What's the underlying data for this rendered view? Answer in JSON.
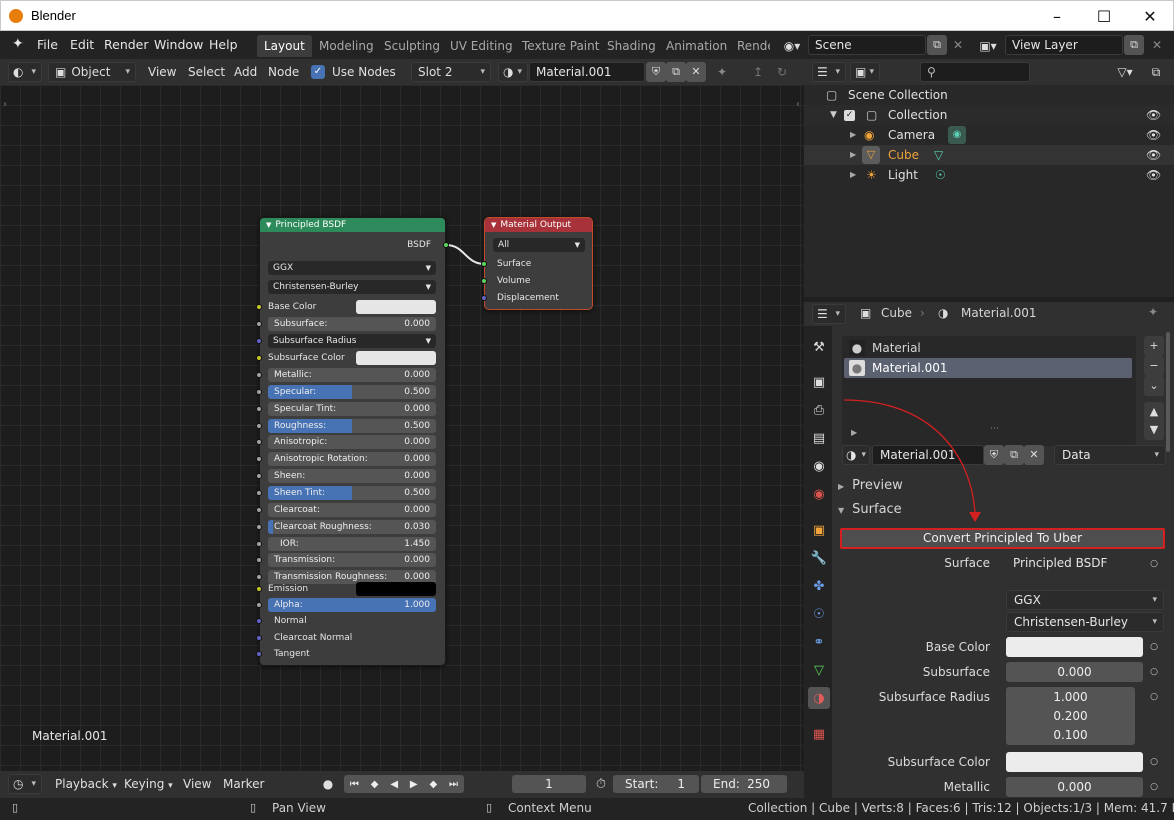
{
  "window": {
    "title": "Blender"
  },
  "menubar": {
    "items": [
      "File",
      "Edit",
      "Render",
      "Window",
      "Help"
    ]
  },
  "workspaces": [
    "Layout",
    "Modeling",
    "Sculpting",
    "UV Editing",
    "Texture Paint",
    "Shading",
    "Animation",
    "Rende"
  ],
  "scene": {
    "name": "Scene",
    "view_layer": "View Layer"
  },
  "node_header": {
    "mode": "Object",
    "view": "View",
    "select": "Select",
    "add": "Add",
    "node": "Node",
    "use_nodes_label": "Use Nodes",
    "use_nodes": true,
    "slot": "Slot 2",
    "material": "Material.001"
  },
  "node_editor": {
    "material_label": "Material.001"
  },
  "principled": {
    "title": "Principled BSDF",
    "output": "BSDF",
    "distribution": "GGX",
    "subsurface_method": "Christensen-Burley",
    "base_color_label": "Base Color",
    "subsurface_label": "Subsurface:",
    "subsurface_value": "0.000",
    "subsurface_radius_label": "Subsurface Radius",
    "subsurface_color_label": "Subsurface Color",
    "sliders": [
      {
        "label": "Metallic:",
        "value": "0.000",
        "fill": 0
      },
      {
        "label": "Specular:",
        "value": "0.500",
        "fill": 0.5
      },
      {
        "label": "Specular Tint:",
        "value": "0.000",
        "fill": 0
      },
      {
        "label": "Roughness:",
        "value": "0.500",
        "fill": 0.5
      },
      {
        "label": "Anisotropic:",
        "value": "0.000",
        "fill": 0
      },
      {
        "label": "Anisotropic Rotation:",
        "value": "0.000",
        "fill": 0
      },
      {
        "label": "Sheen:",
        "value": "0.000",
        "fill": 0
      },
      {
        "label": "Sheen Tint:",
        "value": "0.500",
        "fill": 0.5
      },
      {
        "label": "Clearcoat:",
        "value": "0.000",
        "fill": 0
      },
      {
        "label": "Clearcoat Roughness:",
        "value": "0.030",
        "fill": 0.03
      },
      {
        "label": "IOR:",
        "value": "1.450",
        "fill": 0
      },
      {
        "label": "Transmission:",
        "value": "0.000",
        "fill": 0
      },
      {
        "label": "Transmission Roughness:",
        "value": "0.000",
        "fill": 0
      }
    ],
    "emission_label": "Emission",
    "alpha_label": "Alpha:",
    "alpha_value": "1.000",
    "normal_label": "Normal",
    "clearcoat_normal_label": "Clearcoat Normal",
    "tangent_label": "Tangent"
  },
  "material_output": {
    "title": "Material Output",
    "target": "All",
    "inputs": [
      "Surface",
      "Volume",
      "Displacement"
    ]
  },
  "timeline": {
    "playback": "Playback",
    "keying": "Keying",
    "view": "View",
    "marker": "Marker",
    "frame": "1",
    "start_label": "Start:",
    "start": "1",
    "end_label": "End:",
    "end": "250"
  },
  "status": {
    "pan": "Pan View",
    "context": "Context Menu",
    "info": "Collection | Cube | Verts:8 | Faces:6 | Tris:12 | Objects:1/3 | Mem: 41.7 MB | v2.80.75"
  },
  "outliner": {
    "scene_collection": "Scene Collection",
    "items": [
      {
        "name": "Collection",
        "depth": 1
      },
      {
        "name": "Camera",
        "depth": 2
      },
      {
        "name": "Cube",
        "depth": 2,
        "active": true
      },
      {
        "name": "Light",
        "depth": 2
      }
    ]
  },
  "properties": {
    "object": "Cube",
    "material": "Material.001",
    "slots": [
      "Material",
      "Material.001"
    ],
    "material_name": "Material.001",
    "link": "Data",
    "preview_label": "Preview",
    "surface_panel": "Surface",
    "convert_button": "Convert Principled To Uber",
    "surface_label": "Surface",
    "surface_value": "Principled BSDF",
    "distribution": "GGX",
    "subsurface_method": "Christensen-Burley",
    "base_color_label": "Base Color",
    "subsurface_label": "Subsurface",
    "subsurface_value": "0.000",
    "subsurface_radius_label": "Subsurface Radius",
    "subsurface_radius": [
      "1.000",
      "0.200",
      "0.100"
    ],
    "subsurface_color_label": "Subsurface Color",
    "metallic_label": "Metallic",
    "metallic_value": "0.000"
  },
  "colors": {
    "accent": "#4772b3",
    "shader_header": "#2d8a5a",
    "output_header": "#a7323a",
    "annotation": "#d42020",
    "active_object": "#f0a33b"
  }
}
